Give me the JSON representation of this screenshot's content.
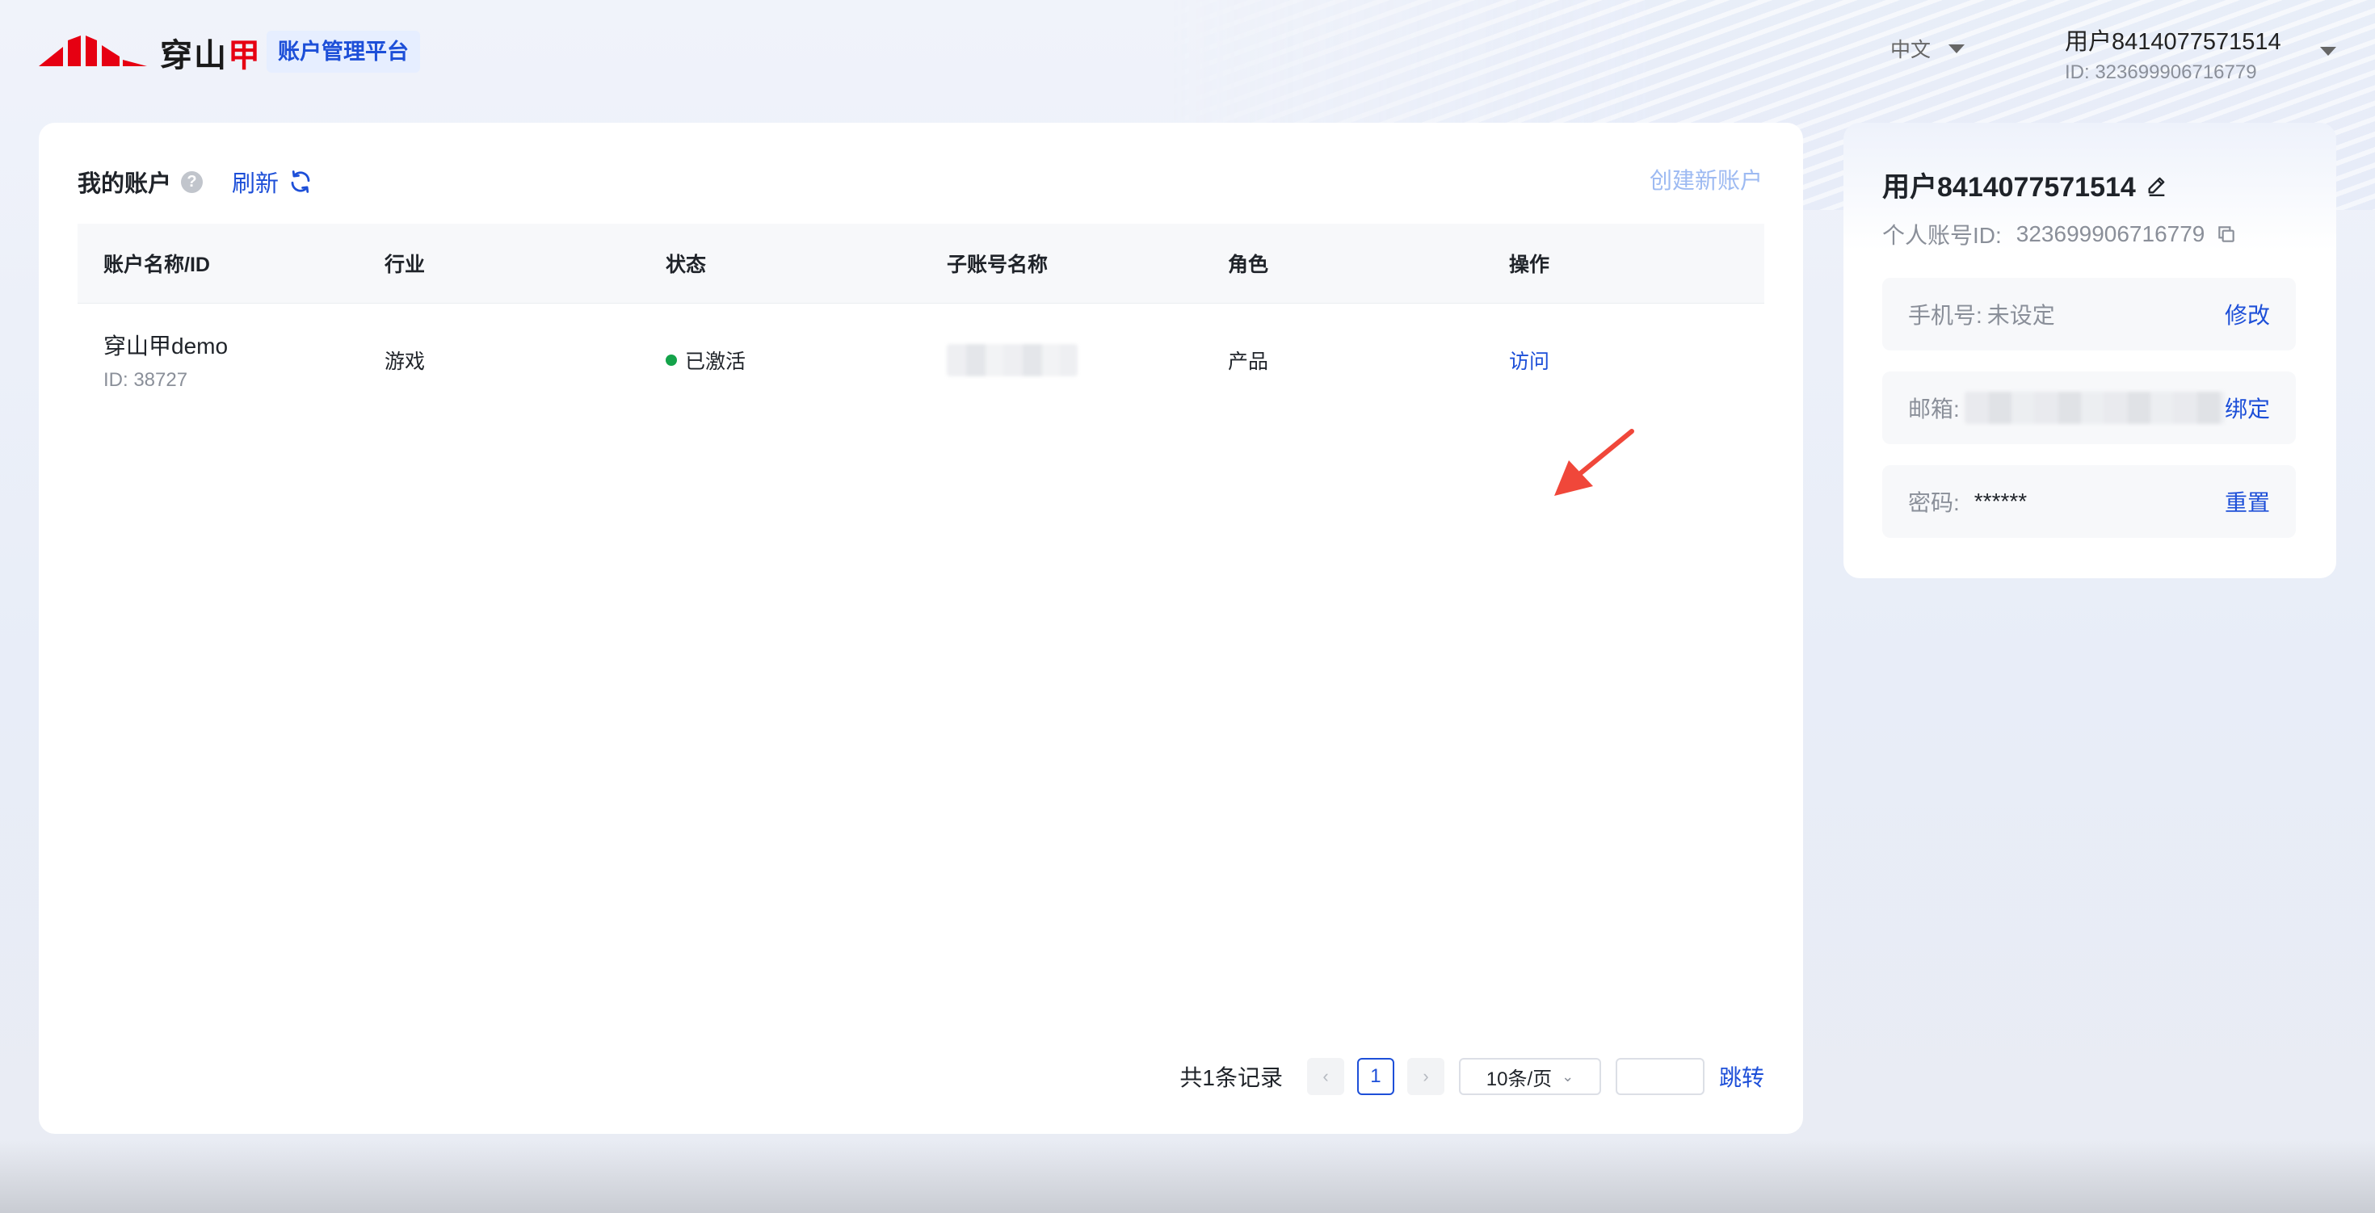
{
  "header": {
    "logo_text_main": "穿山",
    "logo_text_accent": "甲",
    "platform_name": "账户管理平台",
    "language": "中文",
    "user_name": "用户8414077571514",
    "user_id": "ID: 323699906716779"
  },
  "accounts": {
    "title": "我的账户",
    "help_icon": "?",
    "refresh_label": "刷新",
    "create_label": "创建新账户",
    "columns": [
      "账户名称/ID",
      "行业",
      "状态",
      "子账号名称",
      "角色",
      "操作"
    ],
    "rows": [
      {
        "name": "穿山甲demo",
        "id": "ID: 38727",
        "industry": "游戏",
        "status": "已激活",
        "role": "产品",
        "action": "访问"
      }
    ],
    "pagination": {
      "total": "共1条记录",
      "prev": "‹",
      "page": "1",
      "next": "›",
      "page_size": "10条/页",
      "jump_label": "跳转"
    }
  },
  "profile": {
    "name": "用户8414077571514",
    "id_label": "个人账号ID:",
    "id_value": "323699906716779",
    "phone_label": "手机号:",
    "phone_value": "未设定",
    "phone_action": "修改",
    "email_label": "邮箱:",
    "email_action": "绑定",
    "password_label": "密码:",
    "password_value": "******",
    "password_action": "重置"
  },
  "colors": {
    "brand_blue": "#1d4fd8",
    "brand_red": "#e60012",
    "active_green": "#14a34a",
    "annotation_arrow": "#f0473a"
  }
}
